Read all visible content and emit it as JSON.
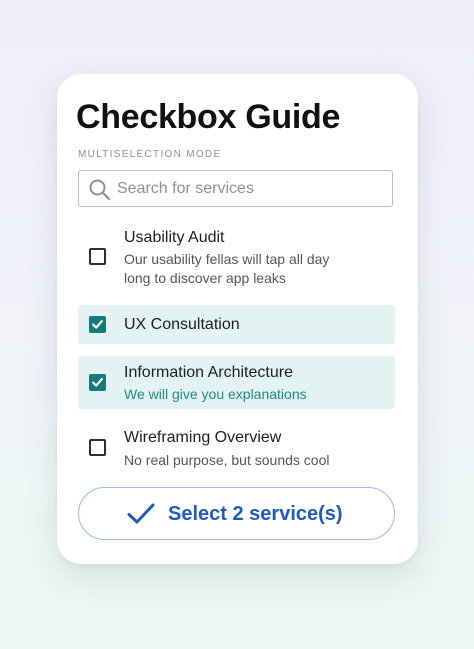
{
  "card": {
    "title": "Checkbox Guide",
    "subtitle": "MULTISELECTION MODE"
  },
  "search": {
    "placeholder": "Search for services",
    "value": ""
  },
  "items": [
    {
      "label": "Usability Audit",
      "desc_line1": "Our usability fellas will tap all day",
      "desc_line2": "long to discover app leaks",
      "checked": false
    },
    {
      "label": "UX Consultation",
      "checked": true
    },
    {
      "label": "Information Architecture",
      "desc_line1": "We will give you explanations",
      "checked": true
    },
    {
      "label": "Wireframing Overview",
      "desc_line1": "No real purpose, but sounds cool",
      "checked": false
    }
  ],
  "cta": {
    "label": "Select 2 service(s)"
  },
  "colors": {
    "accent": "#167a7a",
    "selected_bg": "#e4f3f2",
    "button_text": "#1d5bbf"
  },
  "icons": [
    "search-icon",
    "checkmark-icon"
  ]
}
